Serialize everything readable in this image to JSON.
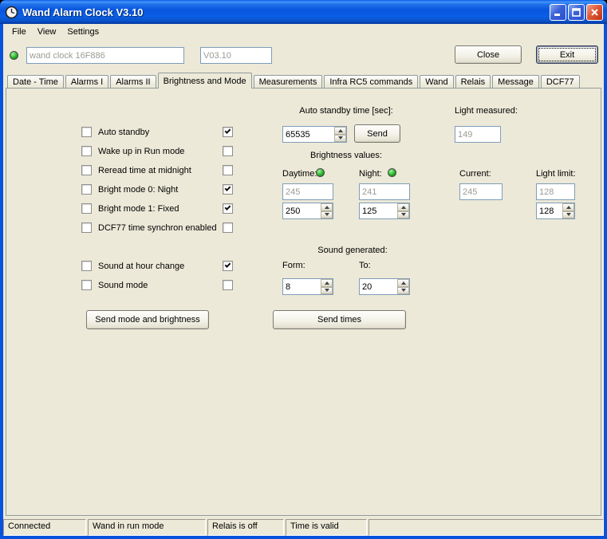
{
  "colors": {
    "chrome_blue": "#0853dd",
    "face": "#ece9d8",
    "led_green": "#1fae1f",
    "field_border": "#7f9db9",
    "disabled_text": "#9c9a92",
    "titlebar_close_red": "#e05a37"
  },
  "titlebar": {
    "title": "Wand Alarm Clock V3.10",
    "icons": [
      "clock-icon",
      "minimize-icon",
      "maximize-icon",
      "close-icon"
    ]
  },
  "menu": {
    "items": [
      "File",
      "View",
      "Settings"
    ]
  },
  "toolbar": {
    "device_name": "wand clock 16F886",
    "version": "V03.10",
    "close_label": "Close",
    "exit_label": "Exit"
  },
  "tabs": {
    "items": [
      "Date - Time",
      "Alarms I",
      "Alarms II",
      "Brightness and Mode",
      "Measurements",
      "Infra RC5 commands",
      "Wand",
      "Relais",
      "Message",
      "DCF77"
    ],
    "selected": "Brightness and Mode",
    "selected_index": 3
  },
  "panel": {
    "modes": [
      {
        "label": "Auto standby",
        "left_checked": false,
        "right_checked": true
      },
      {
        "label": "Wake up in Run mode",
        "left_checked": false,
        "right_checked": false
      },
      {
        "label": "Reread time at midnight",
        "left_checked": false,
        "right_checked": false
      },
      {
        "label": "Bright mode 0: Night",
        "left_checked": false,
        "right_checked": true
      },
      {
        "label": "Bright mode 1: Fixed",
        "left_checked": false,
        "right_checked": true
      },
      {
        "label": "DCF77 time synchron enabled",
        "left_checked": false,
        "right_checked": false
      }
    ],
    "sound_modes": [
      {
        "label": "Sound at hour change",
        "left_checked": false,
        "right_checked": true
      },
      {
        "label": "Sound mode",
        "left_checked": false,
        "right_checked": false
      }
    ],
    "send_mode_button": "Send mode and brightness",
    "auto_standby": {
      "label": "Auto standby time [sec]:",
      "value": "65535",
      "send_button": "Send"
    },
    "light_measured": {
      "label": "Light measured:",
      "value": "149"
    },
    "brightness": {
      "heading": "Brightness values:",
      "daytime_label": "Daytime:",
      "night_label": "Night:",
      "current_label": "Current:",
      "light_limit_label": "Light limit:",
      "daytime_current": "245",
      "night_current": "241",
      "current_value": "245",
      "light_limit_current": "128",
      "daytime_new": "250",
      "night_new": "125",
      "light_limit_new": "128"
    },
    "sound": {
      "heading": "Sound generated:",
      "from_label": "Form:",
      "to_label": "To:",
      "from_value": "8",
      "to_value": "20",
      "send_button": "Send times"
    }
  },
  "statusbar": {
    "segments": [
      "Connected",
      "Wand in run mode",
      "Relais is off",
      "Time is valid",
      ""
    ]
  }
}
